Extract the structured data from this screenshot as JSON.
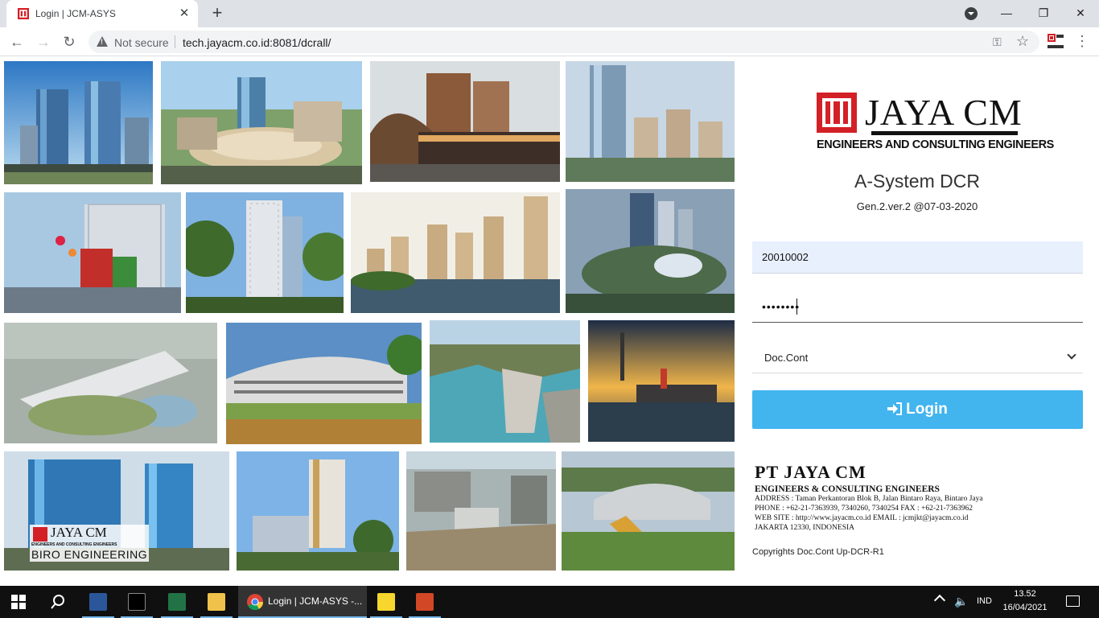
{
  "browser": {
    "tab_title": "Login | JCM-ASYS",
    "new_tab": "+",
    "security_label": "Not secure",
    "url": "tech.jayacm.co.id:8081/dcrall/",
    "window_controls": {
      "minimize": "—",
      "restore": "❐",
      "close": "✕"
    }
  },
  "gallery": {
    "watermark_brand": "JAYA CM",
    "watermark_tag": "ENGINEERS AND CONSULTING ENGINEERS",
    "watermark_unit": "BIRO ENGINEERING"
  },
  "login": {
    "brand_name": "JAYA CM",
    "brand_tagline": "ENGINEERS AND CONSULTING ENGINEERS",
    "system_title": "A-System DCR",
    "version": "Gen.2.ver.2 @07-03-2020",
    "user_id": "20010002",
    "password_mask": "••••••••",
    "module": "Doc.Cont",
    "login_label": "Login",
    "accent_color": "#42b4ee"
  },
  "company": {
    "name": "PT JAYA CM",
    "tagline": "ENGINEERS & CONSULTING ENGINEERS",
    "address": "ADDRESS : Taman Perkantoran Blok B, Jalan Bintaro Raya, Bintaro Jaya",
    "phone": "PHONE : +62-21-7363939, 7340260, 7340254 FAX : +62-21-7363962",
    "web": "WEB SITE : http://www.jayacm.co.id EMAIL : jcmjkt@jayacm.co.id",
    "city": "JAKARTA 12330, INDONESIA",
    "copyright": "Copyrights Doc.Cont Up-DCR-R1"
  },
  "taskbar": {
    "chrome_label": "Login | JCM-ASYS -...",
    "language": "IND",
    "time": "13.52",
    "date": "16/04/2021"
  }
}
